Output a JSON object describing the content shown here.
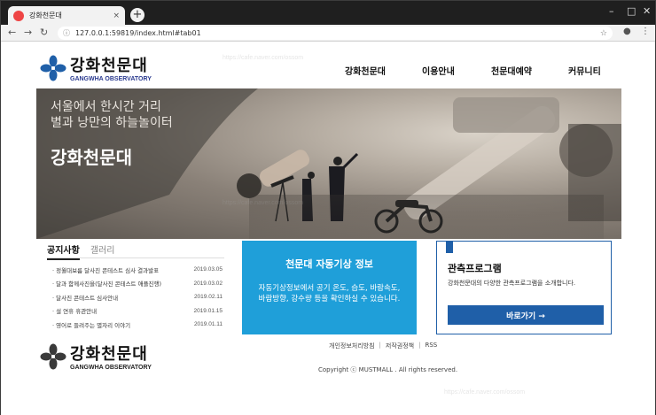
{
  "browser": {
    "tab_title": "강화천문대",
    "tab_close": "×",
    "new_tab": "+",
    "url": "127.0.0.1:59819/index.html#tab01"
  },
  "header": {
    "logo_ko": "강화천문대",
    "logo_en": "GANGWHA OBSERVATORY",
    "menu": [
      "강화천문대",
      "이용안내",
      "천문대예약",
      "커뮤니티"
    ]
  },
  "hero": {
    "tagline_1": "서울에서 한시간 거리",
    "tagline_2": "별과 낭만의 하늘놀이터",
    "title": "강화천문대"
  },
  "notice": {
    "tabs": [
      "공지사항",
      "갤러리"
    ],
    "items": [
      {
        "title": "정월대보름 달사진 콘테스트 심사 결과발표",
        "date": "2019.03.05"
      },
      {
        "title": "달과 함께사진을(달사진 콘테스트 애플진행)",
        "date": "2019.03.02"
      },
      {
        "title": "달사진 콘테스트 심사안내",
        "date": "2019.02.11"
      },
      {
        "title": "설 연휴 휴관안내",
        "date": "2019.01.15"
      },
      {
        "title": "영어로 들려주는 별자리 이야기",
        "date": "2019.01.11"
      }
    ]
  },
  "weather": {
    "title": "천문대 자동기상 정보",
    "desc": "자동기상정보에서 공기 온도, 습도, 바람속도, 바람방향, 강수량 등을 확인하실 수 있습니다."
  },
  "program": {
    "title": "관측프로그램",
    "desc": "강화천문대의 다양한 관측프로그램을 소개합니다.",
    "button": "바로가기 →"
  },
  "footer": {
    "links": [
      "개인정보처리방침",
      "저작권정책",
      "RSS"
    ],
    "copyright": "Copyright ⓒ MUSTMALL . All rights reserved."
  },
  "watermark": "https://cafe.naver.com/ossom",
  "colors": {
    "accent": "#1f5fa8",
    "weather_bg": "#1f9fd9"
  }
}
